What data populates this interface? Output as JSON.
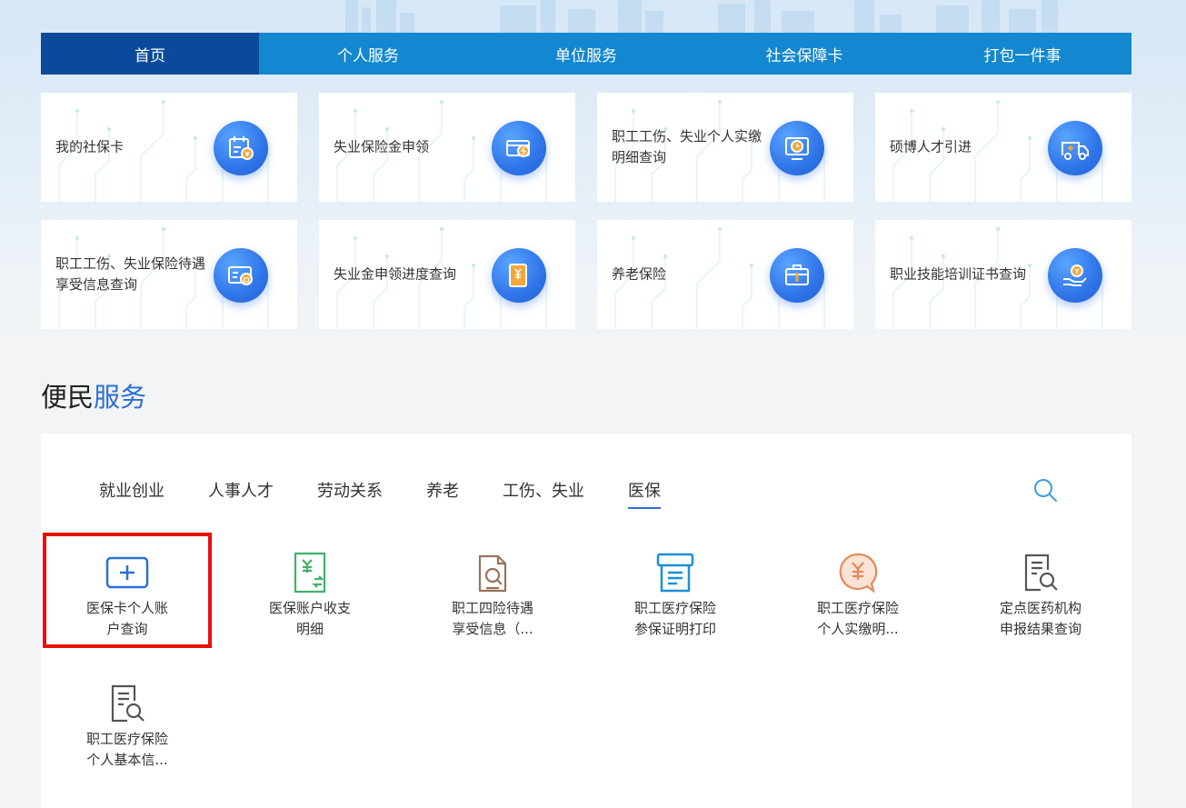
{
  "nav": {
    "items": [
      {
        "label": "首页",
        "active": true
      },
      {
        "label": "个人服务",
        "active": false
      },
      {
        "label": "单位服务",
        "active": false
      },
      {
        "label": "社会保障卡",
        "active": false
      },
      {
        "label": "打包一件事",
        "active": false
      }
    ]
  },
  "cards": [
    {
      "label": "我的社保卡",
      "icon": "social-card-icon"
    },
    {
      "label": "失业保险金申领",
      "icon": "card-lightning-icon"
    },
    {
      "label": "职工工伤、失业个人实缴明细查询",
      "icon": "clock-monitor-icon"
    },
    {
      "label": "硕博人才引进",
      "icon": "ambulance-icon"
    },
    {
      "label": "职工工伤、失业保险待遇享受信息查询",
      "icon": "id-card-lock-icon"
    },
    {
      "label": "失业金申领进度查询",
      "icon": "yuan-document-icon"
    },
    {
      "label": "养老保险",
      "icon": "briefcase-icon"
    },
    {
      "label": "职业技能培训证书查询",
      "icon": "hand-coin-icon"
    }
  ],
  "section": {
    "title_a": "便民",
    "title_b": "服务"
  },
  "tabs": [
    {
      "label": "就业创业",
      "active": false
    },
    {
      "label": "人事人才",
      "active": false
    },
    {
      "label": "劳动关系",
      "active": false
    },
    {
      "label": "养老",
      "active": false
    },
    {
      "label": "工伤、失业",
      "active": false
    },
    {
      "label": "医保",
      "active": true
    }
  ],
  "services": [
    {
      "line1": "医保卡个人账",
      "line2": "户查询",
      "icon": "medical-card-plus-icon",
      "color": "#2a6fd6"
    },
    {
      "line1": "医保账户收支",
      "line2": "明细",
      "icon": "yuan-exchange-icon",
      "color": "#3fb26b"
    },
    {
      "line1": "职工四险待遇",
      "line2": "享受信息（...",
      "icon": "document-search-icon",
      "color": "#9a7259"
    },
    {
      "line1": "职工医疗保险",
      "line2": "参保证明打印",
      "icon": "printer-icon",
      "color": "#1b8fd6"
    },
    {
      "line1": "职工医疗保险",
      "line2": "个人实缴明...",
      "icon": "yuan-chat-icon",
      "color": "#e08a5a"
    },
    {
      "line1": "定点医药机构",
      "line2": "申报结果查询",
      "icon": "list-search-icon",
      "color": "#555555"
    },
    {
      "line1": "职工医疗保险",
      "line2": "个人基本信...",
      "icon": "list-search-icon",
      "color": "#555555"
    }
  ],
  "colors": {
    "nav": "#1387cf",
    "nav_active": "#0b4a9b",
    "accent": "#2a6fd6",
    "highlight": "#e8110c"
  }
}
